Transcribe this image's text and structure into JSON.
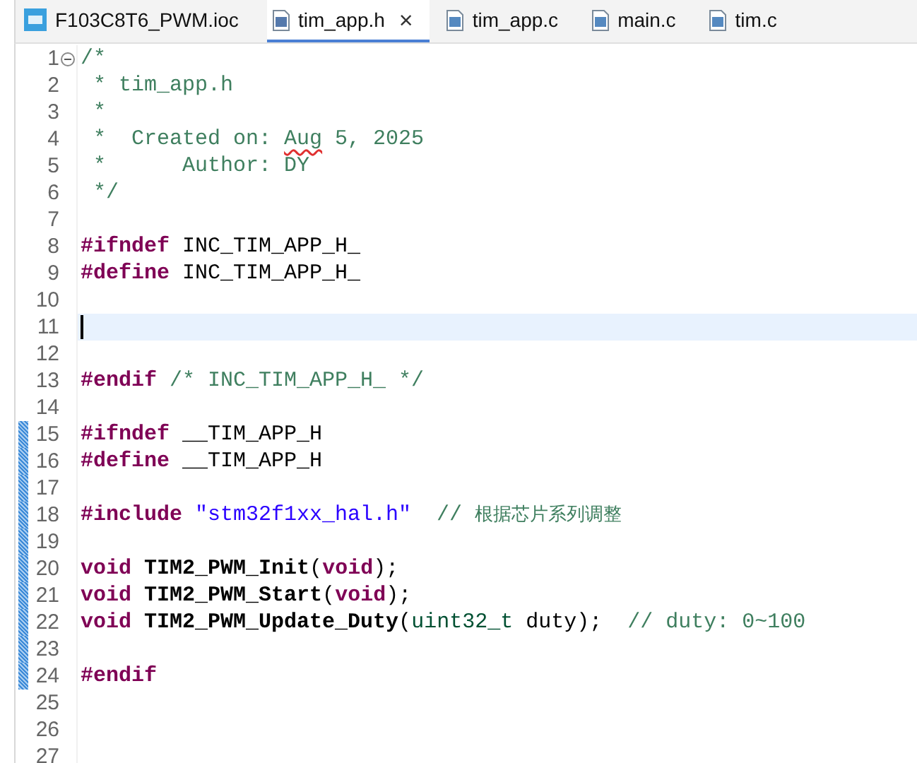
{
  "tabs": [
    {
      "label": "F103C8T6_PWM.ioc",
      "kind": "mx",
      "selected": false
    },
    {
      "label": "tim_app.h",
      "kind": "h",
      "selected": true
    },
    {
      "label": "tim_app.c",
      "kind": "c",
      "selected": false
    },
    {
      "label": "main.c",
      "kind": "c",
      "selected": false
    },
    {
      "label": "tim.c",
      "kind": "c",
      "selected": false
    }
  ],
  "close_glyph": "×",
  "editor": {
    "lines": [
      {
        "number": "1",
        "foldable": true,
        "current": false,
        "changed": false,
        "tokens": [
          {
            "kind": "comment",
            "text": "/*"
          }
        ]
      },
      {
        "number": "2",
        "foldable": false,
        "current": false,
        "changed": false,
        "tokens": [
          {
            "kind": "comment",
            "text": " * tim_app.h"
          }
        ]
      },
      {
        "number": "3",
        "foldable": false,
        "current": false,
        "changed": false,
        "tokens": [
          {
            "kind": "comment",
            "text": " *"
          }
        ]
      },
      {
        "number": "4",
        "foldable": false,
        "current": false,
        "changed": false,
        "tokens": [
          {
            "kind": "comment",
            "text": " *  Created on: "
          },
          {
            "kind": "misspelled",
            "text": "Aug"
          },
          {
            "kind": "comment",
            "text": " 5, 2025"
          }
        ]
      },
      {
        "number": "5",
        "foldable": false,
        "current": false,
        "changed": false,
        "tokens": [
          {
            "kind": "comment",
            "text": " *      Author: DY"
          }
        ]
      },
      {
        "number": "6",
        "foldable": false,
        "current": false,
        "changed": false,
        "tokens": [
          {
            "kind": "comment",
            "text": " */"
          }
        ]
      },
      {
        "number": "7",
        "foldable": false,
        "current": false,
        "changed": false
      },
      {
        "number": "8",
        "foldable": false,
        "current": false,
        "changed": false,
        "tokens": [
          {
            "kind": "keyword",
            "text": "#ifndef"
          },
          {
            "kind": "plain",
            "text": " INC_TIM_APP_H_"
          }
        ]
      },
      {
        "number": "9",
        "foldable": false,
        "current": false,
        "changed": false,
        "tokens": [
          {
            "kind": "keyword",
            "text": "#define"
          },
          {
            "kind": "plain",
            "text": " INC_TIM_APP_H_"
          }
        ]
      },
      {
        "number": "10",
        "foldable": false,
        "current": false,
        "changed": false
      },
      {
        "number": "11",
        "foldable": false,
        "current": true,
        "changed": false
      },
      {
        "number": "12",
        "foldable": false,
        "current": false,
        "changed": false
      },
      {
        "number": "13",
        "foldable": false,
        "current": false,
        "changed": false,
        "tokens": [
          {
            "kind": "keyword",
            "text": "#endif"
          },
          {
            "kind": "comment",
            "text": " /* INC_TIM_APP_H_ */"
          }
        ]
      },
      {
        "number": "14",
        "foldable": false,
        "current": false,
        "changed": false
      },
      {
        "number": "15",
        "foldable": false,
        "current": false,
        "changed": true,
        "tokens": [
          {
            "kind": "keyword",
            "text": "#ifndef"
          },
          {
            "kind": "plain",
            "text": " __TIM_APP_H"
          }
        ]
      },
      {
        "number": "16",
        "foldable": false,
        "current": false,
        "changed": true,
        "tokens": [
          {
            "kind": "keyword",
            "text": "#define"
          },
          {
            "kind": "plain",
            "text": " __TIM_APP_H"
          }
        ]
      },
      {
        "number": "17",
        "foldable": false,
        "current": false,
        "changed": true
      },
      {
        "number": "18",
        "foldable": false,
        "current": false,
        "changed": true,
        "tokens": [
          {
            "kind": "keyword",
            "text": "#include"
          },
          {
            "kind": "string",
            "text": " \"stm32f1xx_hal.h\""
          },
          {
            "kind": "comment",
            "text": "  // 根据芯片系列调整"
          }
        ]
      },
      {
        "number": "19",
        "foldable": false,
        "current": false,
        "changed": true
      },
      {
        "number": "20",
        "foldable": false,
        "current": false,
        "changed": true,
        "tokens": [
          {
            "kind": "keyword",
            "text": "void"
          },
          {
            "kind": "function",
            "text": " TIM2_PWM_Init"
          },
          {
            "kind": "plain",
            "text": "("
          },
          {
            "kind": "keyword",
            "text": "void"
          },
          {
            "kind": "plain",
            "text": ");"
          }
        ]
      },
      {
        "number": "21",
        "foldable": false,
        "current": false,
        "changed": true,
        "tokens": [
          {
            "kind": "keyword",
            "text": "void"
          },
          {
            "kind": "function",
            "text": " TIM2_PWM_Start"
          },
          {
            "kind": "plain",
            "text": "("
          },
          {
            "kind": "keyword",
            "text": "void"
          },
          {
            "kind": "plain",
            "text": ");"
          }
        ]
      },
      {
        "number": "22",
        "foldable": false,
        "current": false,
        "changed": true,
        "tokens": [
          {
            "kind": "keyword",
            "text": "void"
          },
          {
            "kind": "function",
            "text": " TIM2_PWM_Update_Duty"
          },
          {
            "kind": "plain",
            "text": "("
          },
          {
            "kind": "type",
            "text": "uint32_t"
          },
          {
            "kind": "plain",
            "text": " duty);"
          },
          {
            "kind": "comment",
            "text": "  // duty: 0~100"
          }
        ]
      },
      {
        "number": "23",
        "foldable": false,
        "current": false,
        "changed": true
      },
      {
        "number": "24",
        "foldable": false,
        "current": false,
        "changed": true,
        "tokens": [
          {
            "kind": "keyword",
            "text": "#endif"
          }
        ]
      },
      {
        "number": "25",
        "foldable": false,
        "current": false,
        "changed": false
      },
      {
        "number": "26",
        "foldable": false,
        "current": false,
        "changed": false
      },
      {
        "number": "27",
        "foldable": false,
        "current": false,
        "changed": false
      }
    ]
  }
}
